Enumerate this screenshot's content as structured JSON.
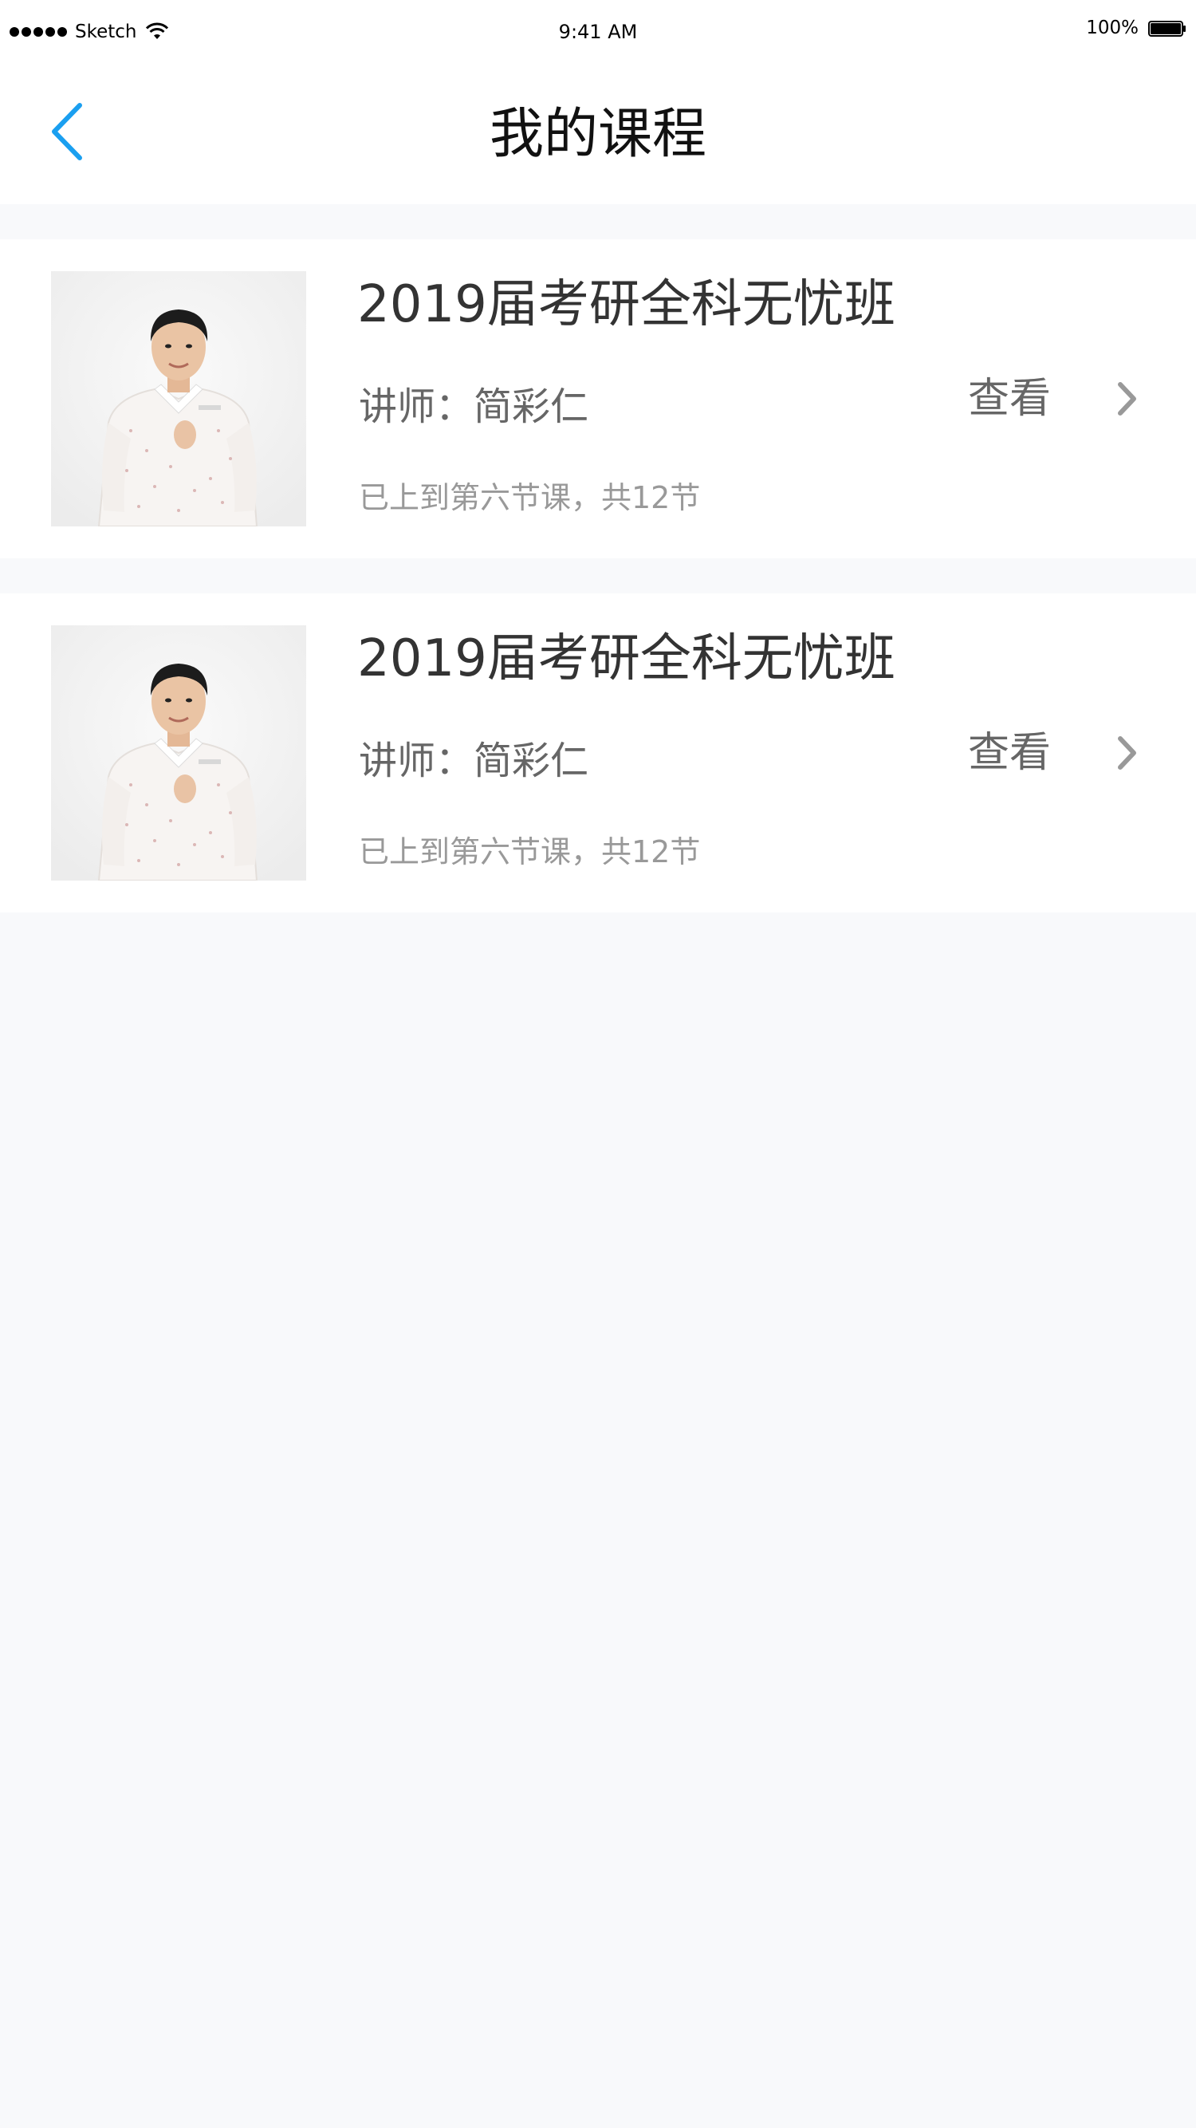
{
  "status_bar": {
    "carrier": "Sketch",
    "time": "9:41 AM",
    "battery": "100%"
  },
  "nav": {
    "title": "我的课程",
    "back_icon": "back-arrow-icon"
  },
  "colors": {
    "accent": "#1a9ff0",
    "background": "#f8f9fb",
    "card": "#ffffff"
  },
  "courses": [
    {
      "title": "2019届考研全科无忧班",
      "teacher": "讲师：简彩仁",
      "progress": "已上到第六节课，共12节",
      "action": "查看"
    },
    {
      "title": "2019届考研全科无忧班",
      "teacher": "讲师：简彩仁",
      "progress": "已上到第六节课，共12节",
      "action": "查看"
    }
  ]
}
